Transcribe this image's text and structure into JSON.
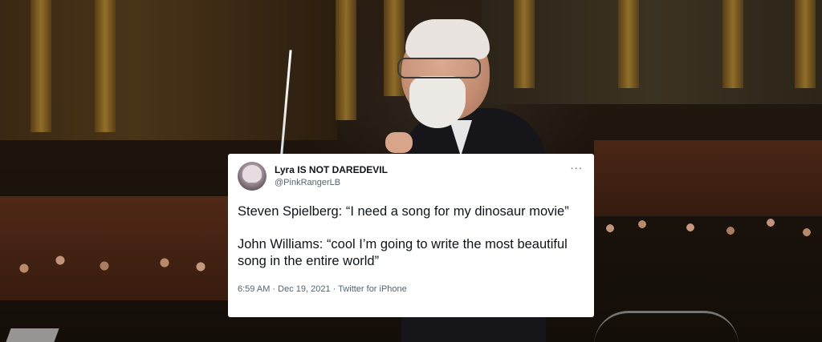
{
  "tweet": {
    "display_name": "Lyra IS NOT DAREDEVIL",
    "handle": "@PinkRangerLB",
    "more_label": "···",
    "body": [
      "Steven Spielberg: “I need a song for my dinosaur movie”",
      "John Williams: “cool I’m going to write the most beautiful song in the entire world”"
    ],
    "time": "6:59 AM",
    "separator": "·",
    "date": "Dec 19, 2021",
    "source": "Twitter for iPhone"
  },
  "icons": {
    "avatar": "profile-avatar",
    "more": "more-options-icon"
  },
  "colors": {
    "card_background": "#ffffff",
    "primary_text": "#0f1419",
    "secondary_text": "#536471"
  }
}
